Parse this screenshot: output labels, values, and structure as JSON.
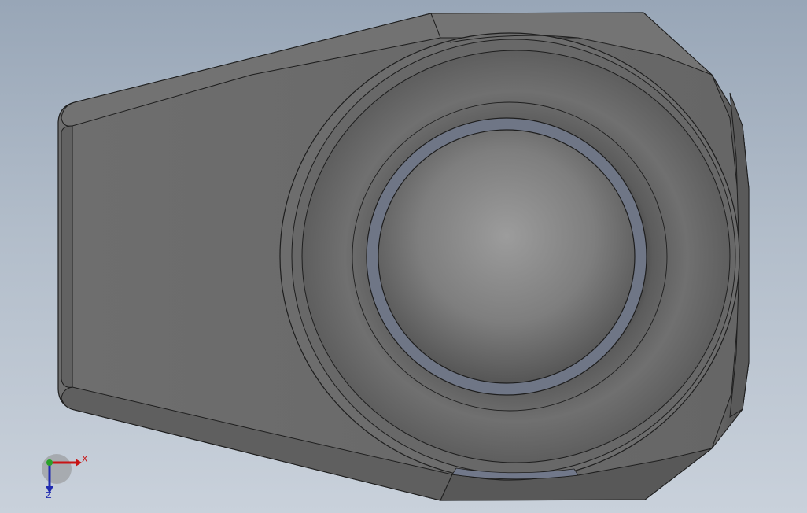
{
  "viewport": {
    "background_top": "#98a6b7",
    "background_bottom": "#c9d1db"
  },
  "part": {
    "body_color": "#6b6b6b",
    "edge_color": "#1e1e1e",
    "ball_highlight": "#9a9a9a",
    "ring_color": "#6f7686"
  },
  "triad": {
    "x_label": "X",
    "z_label": "Z",
    "x_color": "#c81414",
    "y_color": "#2aa12a",
    "z_color": "#1f2ab0",
    "icon": "view-orientation-triad-icon"
  }
}
